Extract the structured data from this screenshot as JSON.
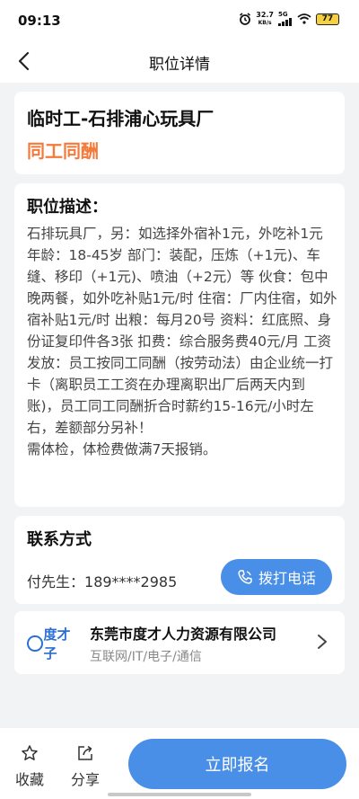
{
  "status_bar": {
    "time": "09:13",
    "net_speed": "32.7",
    "net_unit": "KB/s",
    "network": "5G",
    "battery": "77",
    "icons": [
      "alarm-icon",
      "signal-icon",
      "wifi-icon",
      "battery-icon"
    ]
  },
  "nav": {
    "title": "职位详情",
    "back_icon": "back-arrow-icon"
  },
  "job": {
    "name": "临时工-石排浦心玩具厂",
    "tag": "同工同酬"
  },
  "description": {
    "heading": "职位描述：",
    "body": "石排玩具厂，另：如选择外宿补1元，外吃补1元 年龄：18-45岁 部门：装配，压炼（+1元)、车缝、移印（+1元)、喷油（+2元）等 伙食：包中晚两餐，如外吃补贴1元/时 住宿：厂内住宿，如外宿补贴1元/时 出粮：每月20号 资料：红底照、身份证复印件各3张 扣费：综合服务费40元/月 工资发放：员工按同工同酬（按劳动法）由企业统一打卡（离职员工工资在办理离职出厂后两天内到账)，员工同工同酬折合时薪约15-16元/小时左右，差额部分另补！",
    "body2": "需体检，体检费做满7天报销。"
  },
  "contact": {
    "heading": "联系方式",
    "name_label": "付先生：",
    "phone": "189****2985",
    "call_label": "拨打电话"
  },
  "company": {
    "logo_text": "度才子",
    "name": "东莞市度才人力资源有限公司",
    "industry": "互联网/IT/电子/通信"
  },
  "bottom": {
    "favorite_label": "收藏",
    "share_label": "分享",
    "signup_label": "立即报名"
  },
  "colors": {
    "accent_blue": "#4a8fe7",
    "tag_orange": "#f47a3a",
    "logo_blue": "#2a6fd6"
  }
}
